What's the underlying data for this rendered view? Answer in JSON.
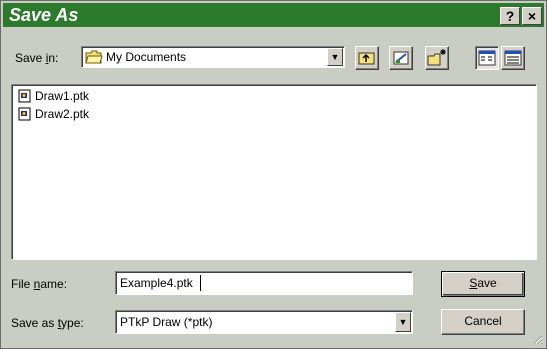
{
  "window": {
    "title": "Save As",
    "help_label": "?",
    "close_label": "×"
  },
  "save_in": {
    "label_pre": "Save ",
    "label_key": "i",
    "label_post": "n:",
    "value": "My Documents"
  },
  "files": [
    {
      "name": "Draw1.ptk",
      "icon": "document-icon"
    },
    {
      "name": "Draw2.ptk",
      "icon": "document-icon"
    }
  ],
  "file_name": {
    "label_pre": "File ",
    "label_key": "n",
    "label_post": "ame:",
    "value": "Example4.ptk"
  },
  "save_as_type": {
    "label_pre": "Save as ",
    "label_key": "t",
    "label_post": "ype:",
    "value": "PTkP Draw (*ptk)"
  },
  "buttons": {
    "save_key": "S",
    "save_rest": "ave",
    "cancel": "Cancel"
  },
  "colors": {
    "title_bar": "#2c7a2c",
    "dialog_bg": "#c9cdc4"
  }
}
